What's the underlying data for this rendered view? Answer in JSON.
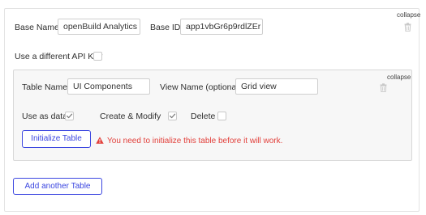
{
  "base": {
    "name_label": "Base Name",
    "name_value": "openBuild Analytics",
    "id_label": "Base ID",
    "id_value": "app1vbGr6p9rdlZEr",
    "collapse_label": "collapse",
    "api_key_label": "Use a different API Key",
    "api_key_checked": false
  },
  "table": {
    "collapse_label": "collapse",
    "name_label": "Table Name",
    "name_value": "UI Components",
    "view_label": "View Name (optional)",
    "view_value": "Grid view",
    "use_as_data_label": "Use as data",
    "use_as_data_checked": true,
    "create_modify_label": "Create & Modify",
    "create_modify_checked": true,
    "delete_label": "Delete",
    "delete_checked": false,
    "initialize_button_label": "Initialize Table",
    "warning_text": "You need to initialize this table before it will work."
  },
  "add_table_button_label": "Add another Table",
  "icons": {
    "trash": "trash-icon",
    "check": "check-icon",
    "warning": "warning-icon"
  },
  "colors": {
    "accent": "#3b46e0",
    "warning": "#e2403b",
    "inner_panel_bg": "#f7f7f7"
  }
}
